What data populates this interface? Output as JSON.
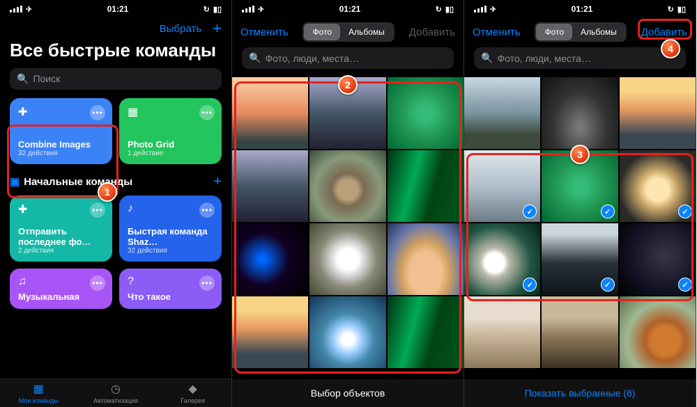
{
  "status": {
    "time": "01:21"
  },
  "screen1": {
    "select_label": "Выбрать",
    "title": "Все быстрые команды",
    "search_placeholder": "Поиск",
    "cards": [
      {
        "title": "Combine Images",
        "sub": "32 действия"
      },
      {
        "title": "Photo Grid",
        "sub": "1 действие"
      },
      {
        "title": "Отправить последнее фо…",
        "sub": "2 действия"
      },
      {
        "title": "Быстрая команда Shaz…",
        "sub": "32 действия"
      },
      {
        "title": "Музыкальная",
        "sub": ""
      },
      {
        "title": "Что такое",
        "sub": ""
      }
    ],
    "section_label": "Начальные команды",
    "tabs": [
      "Мои команды",
      "Автоматизация",
      "Галерея"
    ]
  },
  "picker": {
    "cancel": "Отменить",
    "add": "Добавить",
    "seg_photo": "Фото",
    "seg_albums": "Альбомы",
    "search_ph": "Фото, люди, места…",
    "footer_select": "Выбор объектов",
    "footer_show": "Показать выбранные (6)"
  },
  "badges": {
    "b1": "1",
    "b2": "2",
    "b3": "3",
    "b4": "4"
  }
}
